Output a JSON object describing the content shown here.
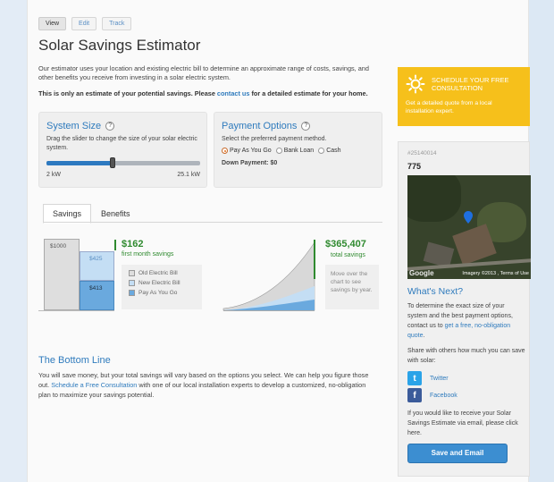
{
  "tabs": [
    "View",
    "Edit",
    "Track"
  ],
  "title": "Solar Savings Estimator",
  "intro": "Our estimator uses your location and existing electric bill to determine an approximate range of costs, savings, and other benefits you receive from investing in a solar electric system.",
  "notice": {
    "prefix": "This is only an estimate of your potential savings. Please ",
    "link": "contact us",
    "suffix": " for a detailed estimate for your home."
  },
  "system_size": {
    "title": "System Size",
    "help": "?",
    "description": "Drag the slider to change the size of your solar electric system.",
    "min_label": "2 kW",
    "max_label": "25.1 kW",
    "slider_fraction": 0.43
  },
  "payment": {
    "title": "Payment Options",
    "help": "?",
    "description": "Select the preferred payment method.",
    "options": [
      "Pay As You Go",
      "Bank Loan",
      "Cash"
    ],
    "selected": "Pay As You Go",
    "down_payment": "Down Payment: $0"
  },
  "result_tabs": [
    "Savings",
    "Benefits"
  ],
  "savings": {
    "bar_labels": [
      "$1000",
      "$425",
      "$413"
    ],
    "first_month_value": "$162",
    "first_month_label": "first month savings",
    "legend": [
      "Old Electric Bill",
      "New Electric Bill",
      "Pay As You Go"
    ],
    "total_value": "$365,407",
    "total_label": "total savings",
    "hover_hint": "Move over the chart to see savings by year."
  },
  "bottom_line": {
    "title": "The Bottom Line",
    "text_before": "You will save money, but your total savings will vary based on the options you select. We can help you figure those out. ",
    "link": "Schedule a Free Consultation",
    "text_after": " with one of our local installation experts to develop a customized, no-obligation plan to maximize your savings potential."
  },
  "consult": {
    "title": "SCHEDULE YOUR FREE CONSULTATION",
    "subtitle": "Get a detailed quote from a local installation expert."
  },
  "property": {
    "id": "#25140014",
    "number": "775",
    "map_credit": "Imagery ©2013 , Terms of Use",
    "map_logo": "Google"
  },
  "whats_next": {
    "title": "What's Next?",
    "text1": "To determine the exact size of your system and the best payment options, contact us to ",
    "text1_link": "get a free, no-obligation quote",
    "text1_end": ".",
    "share": "Share with others how much you can save with solar:",
    "twitter": "Twitter",
    "facebook": "Facebook",
    "email_prompt": "If you would like to receive your Solar Savings Estimate via email, please click here.",
    "button": "Save and Email"
  },
  "colors": {
    "accent": "#2f7bbd",
    "consult_bg": "#f6c01b",
    "button": "#3c8ed1",
    "green": "#2f8a2f"
  }
}
